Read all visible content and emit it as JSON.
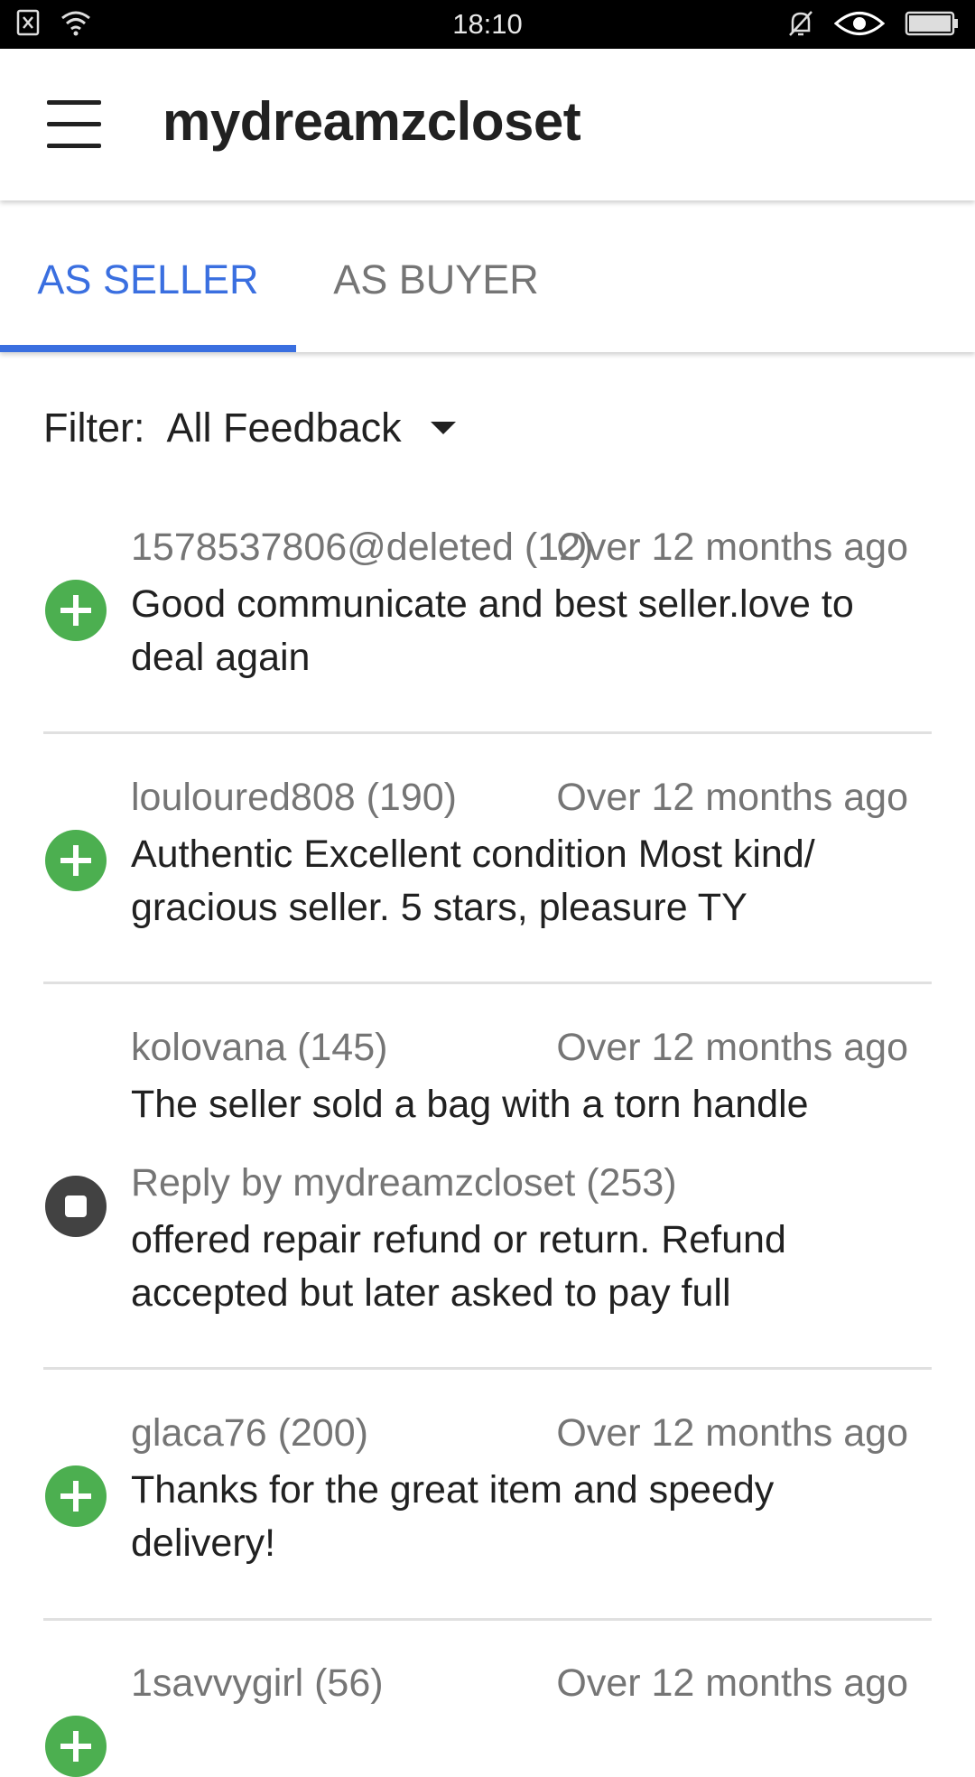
{
  "status_bar": {
    "time": "18:10",
    "icons": [
      "notification-icon",
      "wifi-icon",
      "mute-icon",
      "eye-icon",
      "battery-icon"
    ]
  },
  "app_bar": {
    "title": "mydreamzcloset"
  },
  "tabs": [
    {
      "label": "AS SELLER",
      "active": true
    },
    {
      "label": "AS BUYER",
      "active": false
    }
  ],
  "filter": {
    "label": "Filter:",
    "value": "All Feedback"
  },
  "colors": {
    "accent": "#3a6fe0",
    "positive": "#4caf50",
    "neutral": "#424242"
  },
  "feedback": [
    {
      "type": "positive",
      "user": "1578537806@deleted (12)",
      "time": "Over 12 months ago",
      "comment": "Good communicate and best seller.love to deal again"
    },
    {
      "type": "positive",
      "user": "louloured808 (190)",
      "time": "Over 12 months ago",
      "comment": "Authentic Excellent condition Most kind/ gracious seller. 5 stars, pleasure TY"
    },
    {
      "type": "neutral",
      "user": "kolovana (145)",
      "time": "Over 12 months ago",
      "comment": "The seller sold a bag with a torn handle",
      "reply_by": "Reply by mydreamzcloset (253)",
      "reply": "offered repair refund or return. Refund accepted but later asked to pay full"
    },
    {
      "type": "positive",
      "user": "glaca76 (200)",
      "time": "Over 12 months ago",
      "comment": "Thanks for the great item and speedy delivery!"
    },
    {
      "type": "positive",
      "user": "1savvygirl (56)",
      "time": "Over 12 months ago",
      "comment": ""
    }
  ]
}
